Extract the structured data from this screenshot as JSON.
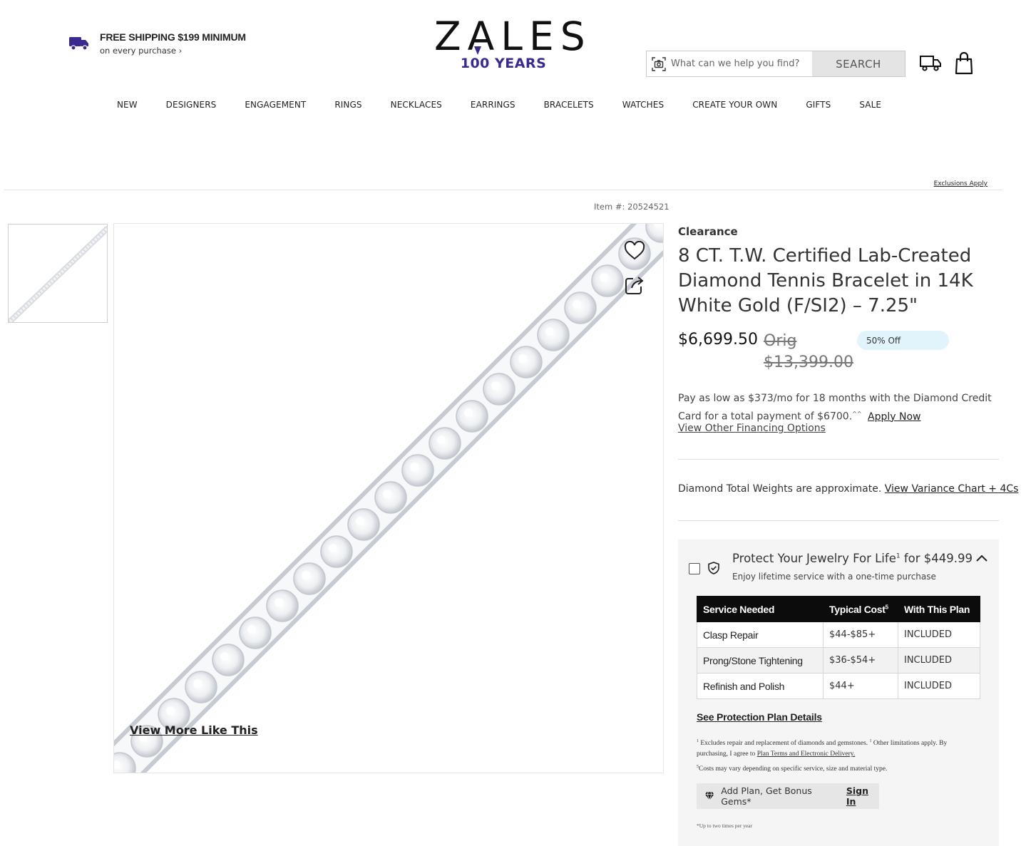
{
  "header": {
    "shipping_title": "FREE SHIPPING $199 MINIMUM",
    "shipping_sub": "on every purchase ›",
    "logo_word": "ZALES",
    "logo_years": "100 YEARS",
    "search_placeholder": "What can we help you find?",
    "search_button": "SEARCH",
    "brand_purple": "#3a2a8f"
  },
  "nav": [
    "NEW",
    "DESIGNERS",
    "ENGAGEMENT",
    "RINGS",
    "NECKLACES",
    "EARRINGS",
    "BRACELETS",
    "WATCHES",
    "CREATE YOUR OWN",
    "GIFTS",
    "SALE"
  ],
  "banner": {
    "exclusions": "Exclusions Apply"
  },
  "gallery": {
    "item_number": "Item #: 20524521",
    "view_more": "View More Like This"
  },
  "product": {
    "badge": "Clearance",
    "title": "8 CT. T.W. Certified Lab-Created Diamond Tennis Bracelet in 14K White Gold (F/SI2) – 7.25\"",
    "price": "$6,699.50",
    "orig_label": "Orig",
    "orig_price": "$13,399.00",
    "discount": "50% Off",
    "financing_text": "Pay as low as $373/mo for 18 months with the Diamond Credit Card for a total payment of $6700.",
    "financing_sup": "^^",
    "apply_now": "Apply Now",
    "other_financing": "View Other Financing Options",
    "dtw_text": "Diamond Total Weights are approximate.",
    "variance_link": "View Variance Chart + 4Cs"
  },
  "protection": {
    "title": "Protect Your Jewelry For Life",
    "title_sup": "1",
    "title_price": " for $449.99",
    "subtitle": "Enjoy lifetime service with a one-time purchase",
    "columns": [
      "Service Needed",
      "Typical Cost",
      "With This Plan"
    ],
    "cost_sup": "5",
    "rows": [
      {
        "service": "Clasp Repair",
        "cost": "$44-$85+",
        "plan": "INCLUDED"
      },
      {
        "service": "Prong/Stone Tightening",
        "cost": "$36-$54+",
        "plan": "INCLUDED"
      },
      {
        "service": "Refinish and Polish",
        "cost": "$44+",
        "plan": "INCLUDED"
      }
    ],
    "see_details": "See Protection Plan Details",
    "fine1_sup": "1",
    "fine1": " Excludes repair and replacement of diamonds and gemstones. ",
    "fine1b_sup": "1",
    "fine1b": " Other limitations apply. By purchasing, I agree to ",
    "fine1_link": "Plan Terms and Electronic Delivery.",
    "fine2_sup": "5",
    "fine2": "Costs may vary depending on specific service, size and material type.",
    "bonus_text": "Add Plan, Get Bonus Gems*",
    "sign_in": "Sign In",
    "twice": "*Up to two times per year"
  }
}
